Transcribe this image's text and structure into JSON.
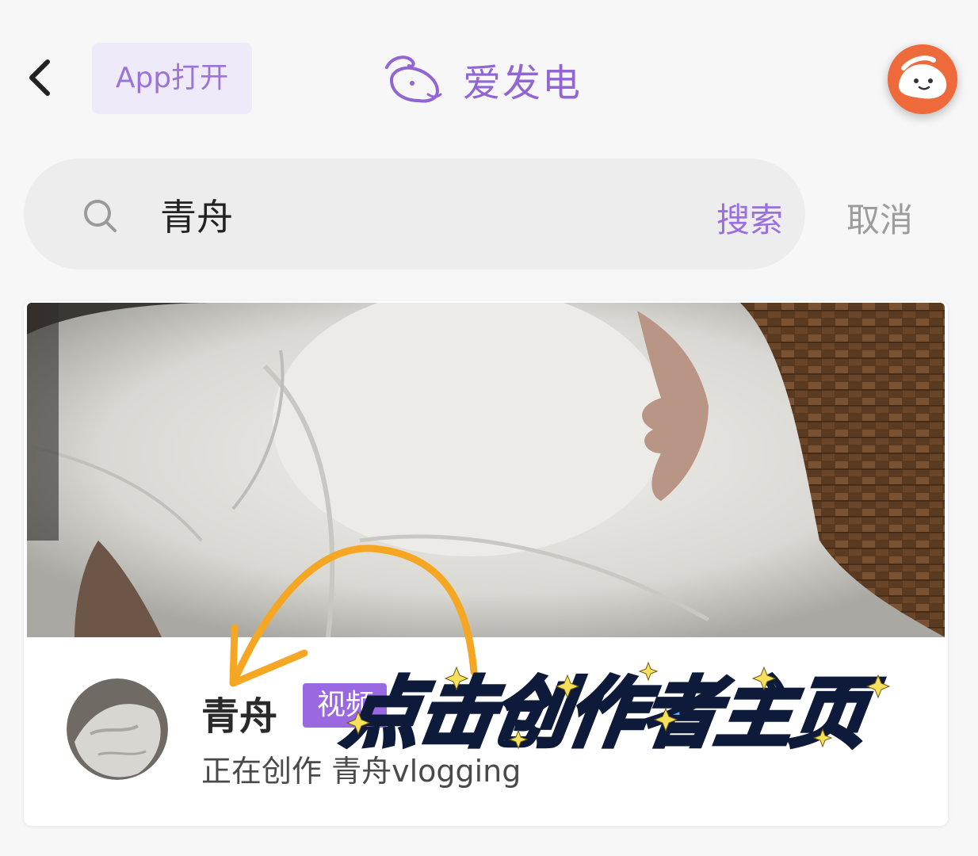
{
  "header": {
    "open_app_label": "App打开",
    "brand_name": "爱发电"
  },
  "search": {
    "value": "青舟",
    "search_label": "搜索",
    "cancel_label": "取消"
  },
  "result": {
    "creator_name": "青舟",
    "tag_label": "视频",
    "description": "正在创作 青舟vlogging"
  },
  "annotation": {
    "text": "点击创作者主页"
  },
  "colors": {
    "brand": "#9265d4",
    "accent": "#9a68e0",
    "annotation_arrow": "#f5a623",
    "annotation_text": "#5bb4f5"
  },
  "icons": [
    "back-icon",
    "brand-logo-icon",
    "search-icon",
    "user-avatar-icon"
  ]
}
